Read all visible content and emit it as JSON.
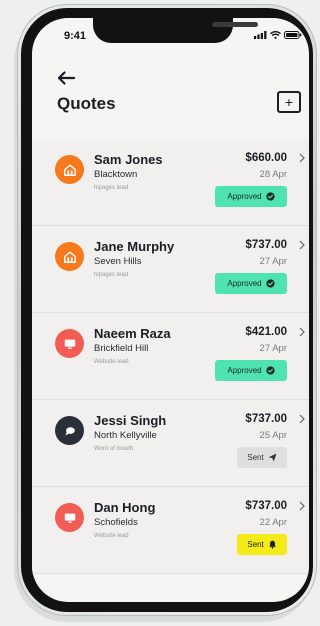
{
  "status_bar": {
    "time": "9:41"
  },
  "header": {
    "title": "Quotes",
    "add_label": "+"
  },
  "colors": {
    "orange": "#f7791c",
    "coral": "#f25c54",
    "dark": "#2b2f3a",
    "approved": "#4fe3b2",
    "sent_grey": "#e0dfdc",
    "sent_yellow": "#f3ea17"
  },
  "quotes": [
    {
      "name": "Sam Jones",
      "suburb": "Blacktown",
      "source": "hipages lead",
      "amount": "$660.00",
      "date": "28 Apr",
      "status": "Approved",
      "status_kind": "approved",
      "avatar_icon": "house-icon",
      "avatar_color": "#f7791c"
    },
    {
      "name": "Jane Murphy",
      "suburb": "Seven Hills",
      "source": "hipages lead",
      "amount": "$737.00",
      "date": "27 Apr",
      "status": "Approved",
      "status_kind": "approved",
      "avatar_icon": "house-icon",
      "avatar_color": "#f7791c"
    },
    {
      "name": "Naeem Raza",
      "suburb": "Brickfield Hill",
      "source": "Website lead",
      "amount": "$421.00",
      "date": "27 Apr",
      "status": "Approved",
      "status_kind": "approved",
      "avatar_icon": "monitor-icon",
      "avatar_color": "#f25c54"
    },
    {
      "name": "Jessi Singh",
      "suburb": "North Kellyville",
      "source": "Word of mouth",
      "amount": "$737.00",
      "date": "25 Apr",
      "status": "Sent",
      "status_kind": "sent-grey",
      "avatar_icon": "speech-bubble-icon",
      "avatar_color": "#2b2f3a"
    },
    {
      "name": "Dan Hong",
      "suburb": "Schofields",
      "source": "Website lead",
      "amount": "$737.00",
      "date": "22 Apr",
      "status": "Sent",
      "status_kind": "sent-yellow",
      "avatar_icon": "monitor-icon",
      "avatar_color": "#f25c54"
    }
  ]
}
